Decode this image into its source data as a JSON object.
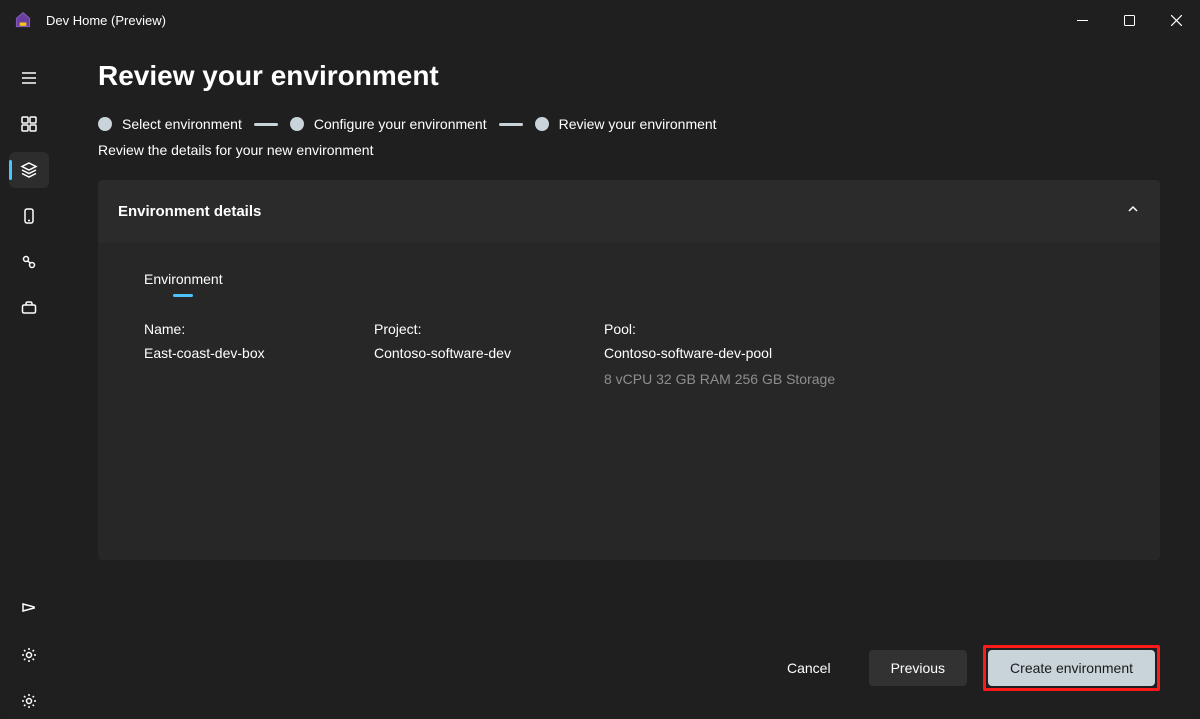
{
  "app": {
    "title": "Dev Home (Preview)"
  },
  "page": {
    "title": "Review your environment",
    "subhead": "Review the details for your new environment"
  },
  "stepper": {
    "steps": [
      {
        "label": "Select environment"
      },
      {
        "label": "Configure your environment"
      },
      {
        "label": "Review your environment"
      }
    ]
  },
  "card": {
    "header": "Environment details",
    "tab": "Environment",
    "fields": {
      "name_label": "Name:",
      "name_value": "East-coast-dev-box",
      "project_label": "Project:",
      "project_value": "Contoso-software-dev",
      "pool_label": "Pool:",
      "pool_value": "Contoso-software-dev-pool",
      "pool_specs": "8 vCPU 32 GB RAM 256 GB Storage"
    }
  },
  "footer": {
    "cancel": "Cancel",
    "previous": "Previous",
    "create": "Create environment"
  }
}
